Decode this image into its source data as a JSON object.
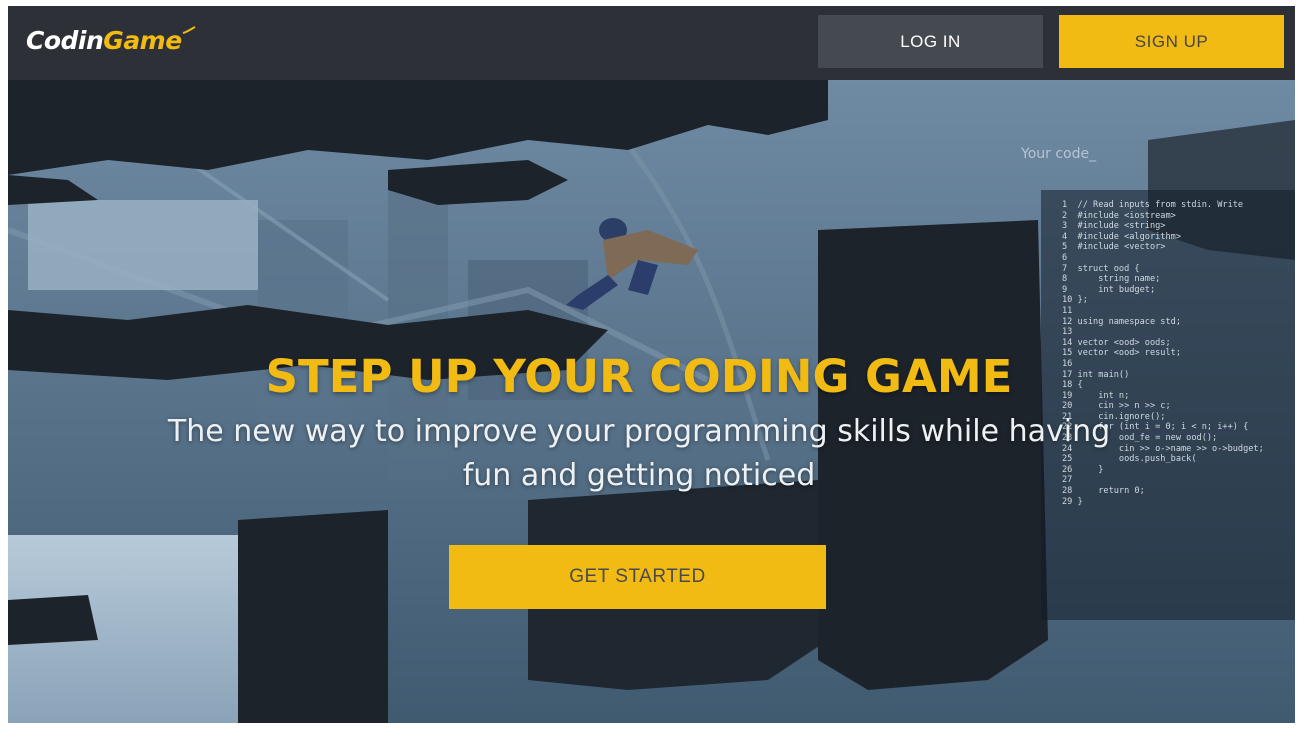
{
  "header": {
    "logo_brand_part1": "Codin",
    "logo_brand_part2": "Game",
    "login_label": "LOG IN",
    "signup_label": "SIGN UP"
  },
  "hero": {
    "title": "STEP UP YOUR CODING GAME",
    "subtitle": "The new way to improve your programming skills while having fun and getting noticed",
    "cta_label": "GET STARTED",
    "code_label": "Your code_",
    "code_lines": [
      "1  // Read inputs from stdin. Write",
      "2  #include <iostream>",
      "3  #include <string>",
      "4  #include <algorithm>",
      "5  #include <vector>",
      "6",
      "7  struct ood {",
      "8      string name;",
      "9      int budget;",
      "10 };",
      "11",
      "12 using namespace std;",
      "13",
      "14 vector <ood> oods;",
      "15 vector <ood> result;",
      "16",
      "17 int main()",
      "18 {",
      "19     int n;",
      "20     cin >> n >> c;",
      "21     cin.ignore();",
      "22     for (int i = 0; i < n; i++) {",
      "23         ood_fe = new ood();",
      "24         cin >> o->name >> o->budget;",
      "25         oods.push_back(",
      "26     }",
      "27",
      "28     return 0;",
      "29 }"
    ]
  },
  "colors": {
    "navbar_bg": "#2d3037",
    "accent_yellow": "#f2bb13",
    "login_bg": "#454950",
    "hero_dark": "#1e252d",
    "hero_blue": "#3d5468"
  }
}
